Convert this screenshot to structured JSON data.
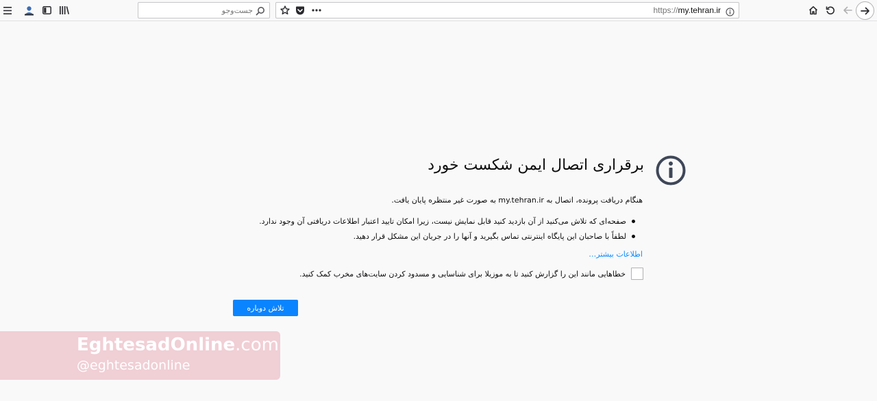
{
  "browser": {
    "url": {
      "scheme": "https://",
      "host": "my.tehran.ir"
    },
    "search": {
      "placeholder": "جست‌وجو"
    },
    "icons": {
      "menu": "hamburger-menu-icon",
      "account": "account-icon",
      "sidebar": "sidebar-icon",
      "library": "library-icon",
      "search": "search-icon",
      "bookmark": "star-icon",
      "pocket": "pocket-icon",
      "more": "more-actions-icon",
      "info": "info-icon",
      "home": "home-icon",
      "reload": "reload-icon",
      "back": "back-arrow-icon",
      "forward": "forward-arrow-icon"
    }
  },
  "error_page": {
    "title": "برقراری اتصال ایمن شکست خورد",
    "intro": "هنگام دریافت پرونده، اتصال به my.tehran.ir به صورت غیر منتظره پایان یافت.",
    "bullets": [
      "صفحه‌ای که تلاش می‌کنید از آن بازدید کنید قابل نمایش نیست، زیرا امکان تایید اعتبار اطلاعات دریافتی آن وجود ندارد.",
      "لطفاً با صاحبان این پایگاه اینترنتی تماس بگیرید و آنها را در جریان این مشکل قرار دهید."
    ],
    "learn_more": "اطلاعات بیشتر…",
    "report_label": "خطاهایی مانند این را گزارش کنید تا به موزیلا برای شناسایی و مسدود کردن سایت‌های مخرب کمک کنید.",
    "retry_label": "تلاش دوباره"
  },
  "watermark": {
    "brand": "EghtesadOnline",
    "brand_suffix": ".com",
    "handle": "@eghtesadonline"
  },
  "colors": {
    "accent": "#0a84ff",
    "link": "#0a8dff",
    "background": "#f9f9fa"
  }
}
